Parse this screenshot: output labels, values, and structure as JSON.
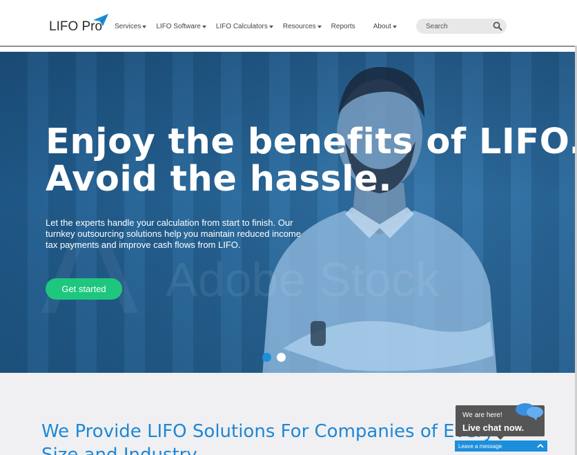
{
  "header": {
    "logo_text": "LIFO Pro",
    "nav": [
      {
        "label": "Services",
        "dropdown": true
      },
      {
        "label": "LIFO Software",
        "dropdown": true
      },
      {
        "label": "LIFO Calculators",
        "dropdown": true
      },
      {
        "label": "Resources",
        "dropdown": true
      },
      {
        "label": "Reports",
        "dropdown": false
      },
      {
        "label": "About",
        "dropdown": true
      }
    ],
    "search_placeholder": "Search"
  },
  "hero": {
    "title_line1": "Enjoy the benefits of LIFO.",
    "title_line2": "Avoid the hassle.",
    "subtitle": "Let the experts handle your calculation from start to finish. Our turnkey outsourcing solutions help you maintain reduced income tax payments and improve cash flows from LIFO.",
    "cta_label": "Get started",
    "watermark": "Adobe Stock",
    "slides": [
      {
        "active": true
      },
      {
        "active": false
      }
    ]
  },
  "section": {
    "title_line1": "We Provide LIFO Solutions For Companies of Every",
    "title_line2": "Size and Industry"
  },
  "chat": {
    "line1": "We are here!",
    "line2": "Live chat now.",
    "leave_message": "Leave a message"
  },
  "colors": {
    "accent_blue": "#1e87d6",
    "cta_green": "#1ec77d",
    "chat_grey": "#555555",
    "chat_bar_blue": "#1c8fdc"
  }
}
